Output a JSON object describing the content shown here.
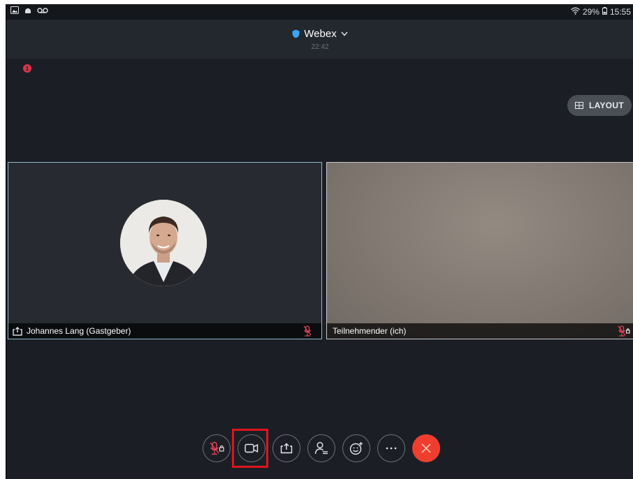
{
  "status_bar": {
    "battery_text": "29%",
    "time": "15:55",
    "left_icons": [
      "gallery-icon",
      "android-icon",
      "voicemail-icon"
    ]
  },
  "header": {
    "title": "Webex",
    "duration": "22:42"
  },
  "notification_badge": {
    "count": "1"
  },
  "layout_button": {
    "label": "LAYOUT"
  },
  "participants": [
    {
      "name": "Johannes Lang (Gastgeber)",
      "role": "host",
      "muted": true,
      "sharing_icon": true
    },
    {
      "name": "Teilnehmender (ich)",
      "role": "self",
      "muted": true
    }
  ],
  "controls": [
    {
      "id": "mute",
      "icon": "mic-muted-icon"
    },
    {
      "id": "video",
      "icon": "video-icon",
      "highlighted": true
    },
    {
      "id": "share",
      "icon": "share-icon"
    },
    {
      "id": "participants",
      "icon": "participants-icon"
    },
    {
      "id": "reactions",
      "icon": "reaction-icon"
    },
    {
      "id": "more",
      "icon": "more-icon"
    },
    {
      "id": "leave",
      "icon": "close-icon"
    }
  ],
  "colors": {
    "accent_red": "#e0141e",
    "leave_red": "#ef3e2f",
    "active_speaker_border": "#8fb7cb",
    "mute_red": "#e8455a",
    "background": "#1b1f25"
  }
}
